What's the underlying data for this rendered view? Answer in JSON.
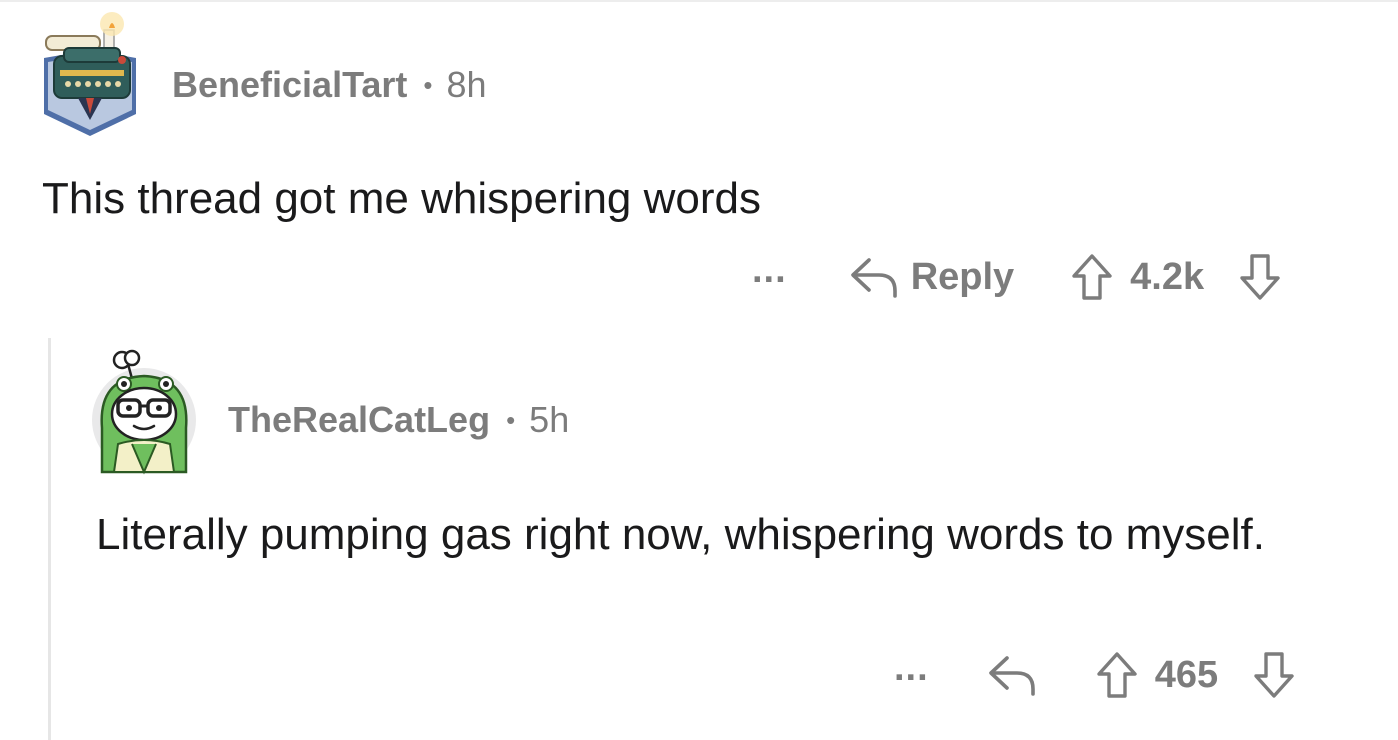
{
  "comments": [
    {
      "username": "BeneficialTart",
      "separator": "•",
      "time": "8h",
      "text": "This thread got me whispering words",
      "more_label": "...",
      "reply_label": "Reply",
      "score": "4.2k",
      "avatar_icon": "typewriter-avatar-icon"
    },
    {
      "username": "TheRealCatLeg",
      "separator": "•",
      "time": "5h",
      "text": "Literally pumping gas right now, whispering words to myself.",
      "more_label": "...",
      "reply_label": "",
      "score": "465",
      "avatar_icon": "frog-hood-avatar-icon"
    }
  ],
  "colors": {
    "meta_text": "#7c7c7c",
    "body_text": "#1a1a1b",
    "thread_line": "#e6e6e6",
    "background": "#ffffff"
  }
}
